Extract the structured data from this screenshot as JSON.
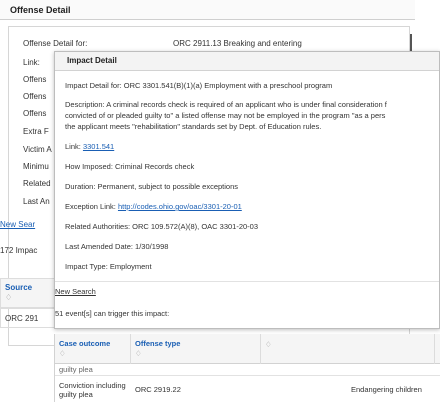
{
  "background": {
    "title": "Offense Detail",
    "rows": [
      {
        "label": "Offense Detail for:",
        "value": "ORC 2911.13 Breaking and entering"
      },
      {
        "label": "Link:",
        "value": ""
      },
      {
        "label": "Offens",
        "value": ""
      },
      {
        "label": "Offens",
        "value": ""
      },
      {
        "label": "Offens",
        "value": ""
      },
      {
        "label": "Extra F",
        "value": ""
      },
      {
        "label": "Victim A",
        "value": ""
      },
      {
        "label": "Minimu",
        "value": ""
      },
      {
        "label": "Related",
        "value": ""
      },
      {
        "label": "Last An",
        "value": ""
      }
    ],
    "new_search": "New Sear",
    "impacts_count": "172 Impac",
    "table_header": "Source",
    "table_sort": "♢",
    "table_cell": "ORC 291"
  },
  "modal": {
    "title": "Impact Detail",
    "impact_detail_for": "Impact Detail for: ORC 3301.541(B)(1)(a) Employment with a preschool program",
    "description_line1": "Description: A criminal records check is required of an applicant who is under final consideration f",
    "description_line2": "convicted of or pleaded guilty to\" a listed offense may not be employed in the program \"as a pers",
    "description_line3": "the applicant meets \"rehabilitation\" standards set by Dept. of Education rules.",
    "link_label": "Link: ",
    "link_text": "3301.541",
    "how_imposed": "How Imposed: Criminal Records check",
    "duration": "Duration: Permanent, subject to possible exceptions",
    "exception_label": "Exception Link: ",
    "exception_link": "http://codes.ohio.gov/oac/3301-20-01",
    "related_authorities": "Related Authorities: ORC 109.572(A)(8), OAC 3301-20-03",
    "last_amended": "Last Amended Date: 1/30/1998",
    "impact_type": "Impact Type: Employment",
    "new_search": "New Search",
    "events_count": "51 event[s] can trigger this impact:"
  },
  "events_table": {
    "columns": [
      {
        "label": "Case outcome",
        "sort": "♢"
      },
      {
        "label": "Offense type",
        "sort": "♢"
      },
      {
        "label": "",
        "sort": "♢"
      },
      {
        "label": "",
        "sort": ""
      }
    ],
    "partial_row": "guilty plea",
    "rows": [
      {
        "outcome_line1": "Conviction including",
        "outcome_line2": "guilty plea",
        "offense": "ORC 2919.22",
        "description": "Endangering children"
      }
    ]
  }
}
